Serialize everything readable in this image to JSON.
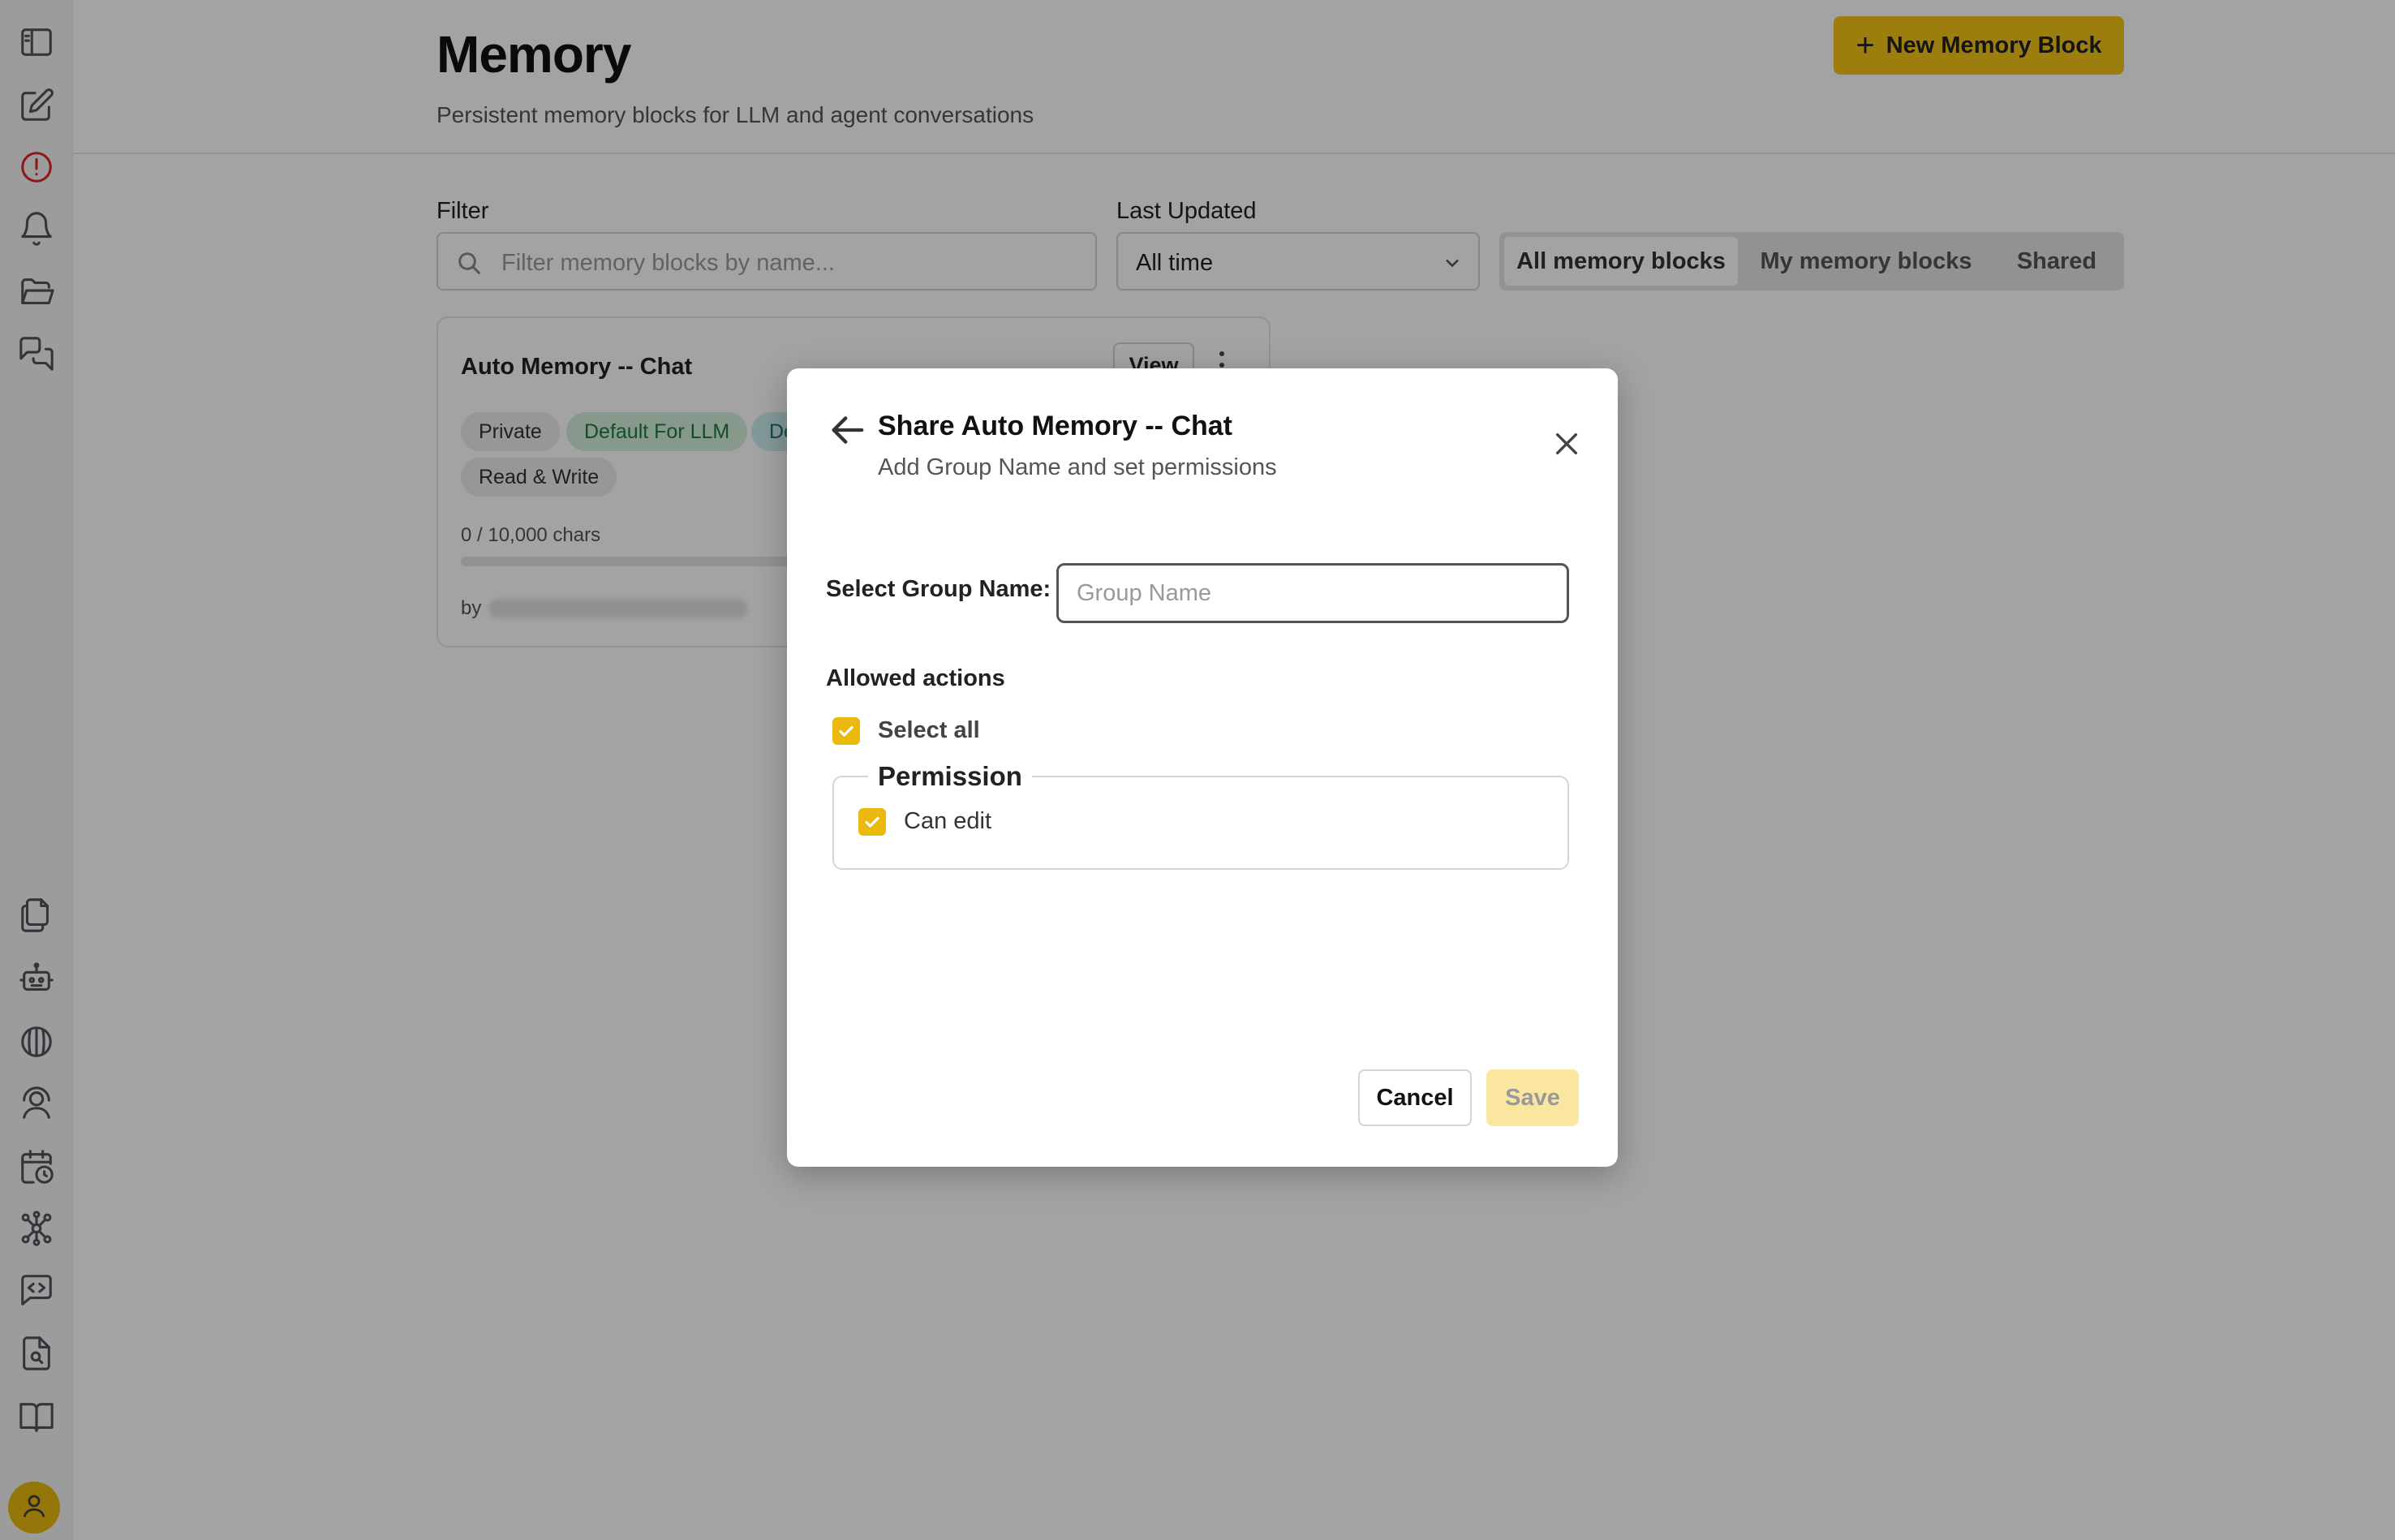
{
  "sidebar": {
    "top_icons": [
      "sidebar-toggle-icon",
      "edit-icon",
      "alert-icon",
      "bell-icon",
      "folder-icon",
      "chat-icon"
    ],
    "bottom_icons": [
      "files-icon",
      "robot-icon",
      "brain-icon",
      "agent-icon",
      "calendar-clock-icon",
      "network-icon",
      "code-chat-icon",
      "file-search-icon",
      "book-icon"
    ],
    "avatar_icon": "user-icon"
  },
  "header": {
    "title": "Memory",
    "subtitle": "Persistent memory blocks for LLM and agent conversations",
    "new_button_label": "New Memory Block"
  },
  "filters": {
    "filter_label": "Filter",
    "filter_placeholder": "Filter memory blocks by name...",
    "last_updated_label": "Last Updated",
    "last_updated_value": "All time",
    "segments": [
      {
        "label": "All memory blocks",
        "active": true
      },
      {
        "label": "My memory blocks",
        "active": false
      },
      {
        "label": "Shared",
        "active": false
      }
    ]
  },
  "card": {
    "title": "Auto Memory -- Chat",
    "view_label": "View",
    "tags": [
      {
        "label": "Private",
        "style": "gray"
      },
      {
        "label": "Default For LLM",
        "style": "green"
      },
      {
        "label": "De",
        "style": "teal"
      },
      {
        "label": "Read & Write",
        "style": "gray"
      }
    ],
    "chars": "0 / 10,000 chars",
    "by": "by"
  },
  "modal": {
    "title": "Share Auto Memory -- Chat",
    "subtitle": "Add Group Name and set permissions",
    "group_label": "Select Group Name:",
    "group_placeholder": "Group Name",
    "group_value": "",
    "allowed_actions": "Allowed actions",
    "select_all_label": "Select all",
    "select_all_checked": true,
    "permission_legend": "Permission",
    "can_edit_label": "Can edit",
    "can_edit_checked": true,
    "cancel_label": "Cancel",
    "save_label": "Save"
  },
  "colors": {
    "accent": "#f5c518",
    "checkbox": "#e9b90f",
    "alert": "#dc2626",
    "save_disabled": "#fbe6a0"
  }
}
